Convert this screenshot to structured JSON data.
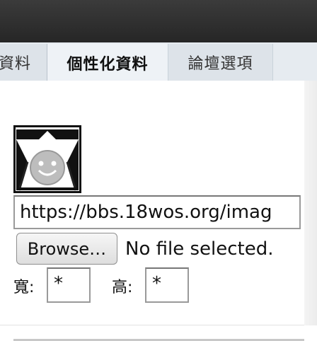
{
  "tabs": [
    {
      "label": "資料",
      "active": false
    },
    {
      "label": "個性化資料",
      "active": true
    },
    {
      "label": "論壇選項",
      "active": false
    }
  ],
  "avatar": {
    "icon": "smiley-face-avatar"
  },
  "avatar_url": {
    "value": "https://bbs.18wos.org/imag"
  },
  "file_upload": {
    "button_label": "Browse…",
    "status": "No file selected."
  },
  "dimensions": {
    "width_label": "寬:",
    "width_value": "*",
    "height_label": "高:",
    "height_value": "*"
  }
}
